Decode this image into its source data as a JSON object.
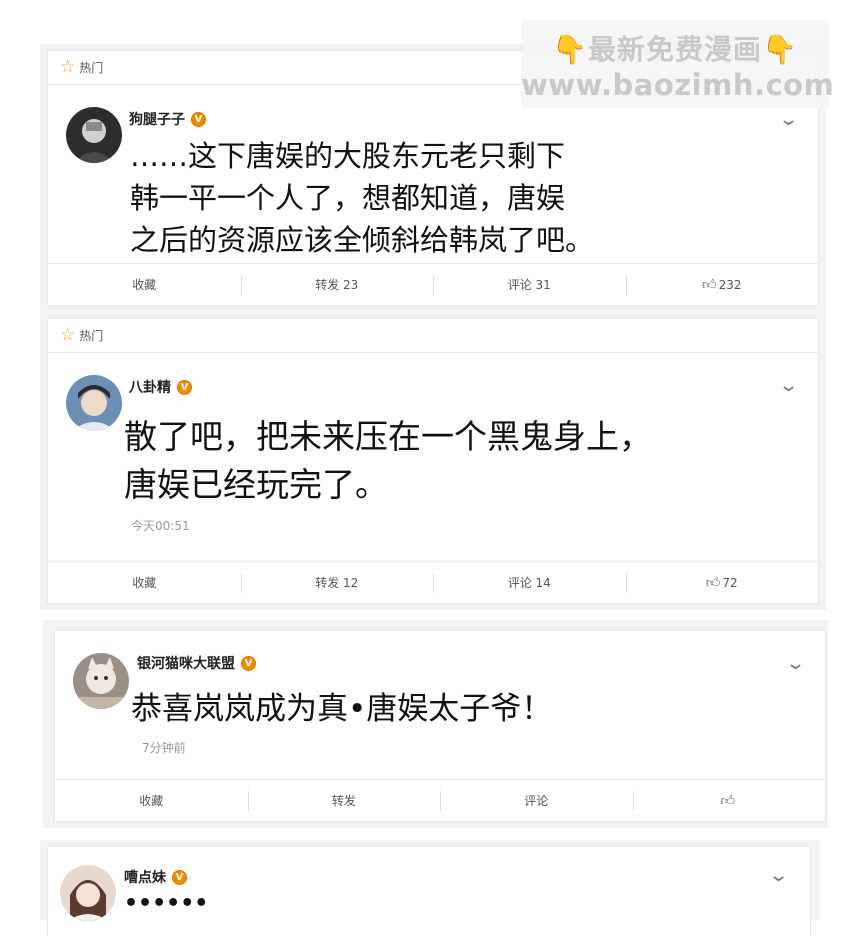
{
  "watermark": {
    "line1": "最新免费漫画",
    "line2": "www.baozimh.com"
  },
  "posts": [
    {
      "hot_label": "热门",
      "username": "狗腿子子",
      "badge": "V",
      "text": "……这下唐娱的大股东元老只剩下\n韩一平一个人了，想都知道，唐娱\n之后的资源应该全倾斜给韩岚了吧。",
      "actions": {
        "fav": "收藏",
        "repost": "转发 23",
        "comment": "评论 31",
        "like": "232"
      }
    },
    {
      "hot_label": "热门",
      "username": "八卦精",
      "badge": "V",
      "text": "散了吧，把未来压在一个黑鬼身上，\n唐娱已经玩完了。",
      "time": "今天00:51",
      "actions": {
        "fav": "收藏",
        "repost": "转发 12",
        "comment": "评论 14",
        "like": "72"
      }
    },
    {
      "username": "银河猫咪大联盟",
      "badge": "V",
      "text": "恭喜岚岚成为真•唐娱太子爷！",
      "time": "7分钟前",
      "actions": {
        "fav": "收藏",
        "repost": "转发",
        "comment": "评论",
        "like": ""
      }
    },
    {
      "username": "嘈点妹",
      "badge": "V",
      "text": "••••••"
    }
  ]
}
